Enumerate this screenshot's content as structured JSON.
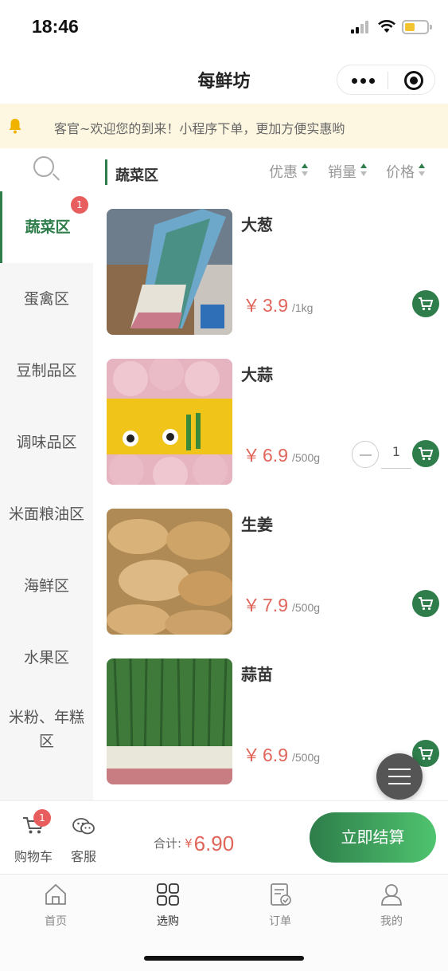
{
  "status_bar": {
    "time": "18:46"
  },
  "app": {
    "title": "每鲜坊"
  },
  "notice": {
    "text": "客官~欢迎您的到来！小程序下单，更加方便实惠哟"
  },
  "sidebar": {
    "categories": [
      {
        "label": "蔬菜区",
        "badge": "1",
        "active": true
      },
      {
        "label": "蛋禽区"
      },
      {
        "label": "豆制品区"
      },
      {
        "label": "调味品区"
      },
      {
        "label": "米面粮油区"
      },
      {
        "label": "海鲜区"
      },
      {
        "label": "水果区"
      },
      {
        "label": "米粉、年糕区"
      }
    ]
  },
  "list": {
    "section_title": "蔬菜区",
    "sort_options": [
      "优惠",
      "销量",
      "价格"
    ]
  },
  "products": [
    {
      "name": "大葱",
      "currency": "￥",
      "price": "3.9",
      "unit": "/1kg"
    },
    {
      "name": "大蒜",
      "currency": "￥",
      "price": "6.9",
      "unit": "/500g",
      "quantity": "1"
    },
    {
      "name": "生姜",
      "currency": "￥",
      "price": "7.9",
      "unit": "/500g"
    },
    {
      "name": "蒜苗",
      "currency": "￥",
      "price": "6.9",
      "unit": "/500g"
    }
  ],
  "checkout": {
    "cart_label": "购物车",
    "cart_badge": "1",
    "service_label": "客服",
    "total_label": "合计:",
    "currency": "¥",
    "total_amount": "6.90",
    "pay_label": "立即结算"
  },
  "tabbar": {
    "tabs": [
      {
        "label": "首页",
        "icon": "home-icon"
      },
      {
        "label": "选购",
        "icon": "grid-icon",
        "active": true
      },
      {
        "label": "订单",
        "icon": "order-icon"
      },
      {
        "label": "我的",
        "icon": "user-icon"
      }
    ]
  },
  "colors": {
    "accent": "#2e7d4a",
    "price": "#e0655a",
    "badge": "#e85d5d",
    "notice_bg": "#fdf6e0"
  }
}
